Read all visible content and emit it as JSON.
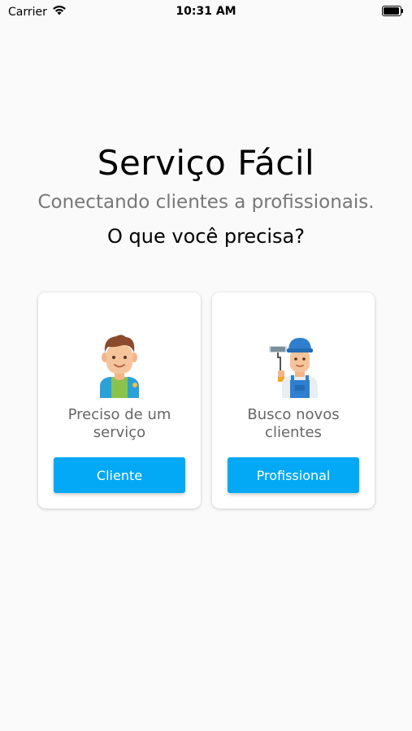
{
  "status_bar": {
    "carrier": "Carrier",
    "time": "10:31 AM"
  },
  "header": {
    "title": "Serviço Fácil",
    "subtitle": "Conectando clientes a profissionais.",
    "question": "O que você precisa?"
  },
  "cards": [
    {
      "text": "Preciso de um serviço",
      "button_label": "Cliente",
      "icon": "client-avatar-icon"
    },
    {
      "text": "Busco novos clientes",
      "button_label": "Profissional",
      "icon": "painter-worker-icon"
    }
  ],
  "colors": {
    "accent": "#03a9f4",
    "background": "#fafafa"
  }
}
